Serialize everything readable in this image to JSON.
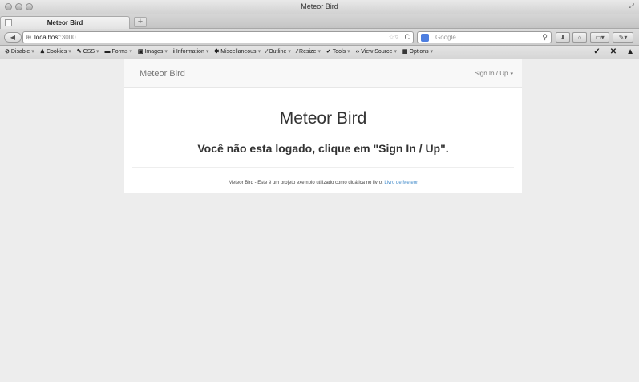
{
  "window": {
    "title": "Meteor Bird"
  },
  "tabs": [
    {
      "title": "Meteor Bird"
    }
  ],
  "navbar": {
    "url_host": "localhost",
    "url_port": ":3000",
    "search_placeholder": "Google"
  },
  "devbar": {
    "items": [
      {
        "glyph": "⊘",
        "label": "Disable"
      },
      {
        "glyph": "♟",
        "label": "Cookies"
      },
      {
        "glyph": "✎",
        "label": "CSS"
      },
      {
        "glyph": "▬",
        "label": "Forms"
      },
      {
        "glyph": "▣",
        "label": "Images"
      },
      {
        "glyph": "i",
        "label": "Information"
      },
      {
        "glyph": "✱",
        "label": "Miscellaneous"
      },
      {
        "glyph": "⁄",
        "label": "Outline"
      },
      {
        "glyph": "⁄",
        "label": "Resize"
      },
      {
        "glyph": "✔",
        "label": "Tools"
      },
      {
        "glyph": "‹›",
        "label": "View Source"
      },
      {
        "glyph": "▦",
        "label": "Options"
      }
    ]
  },
  "page": {
    "brand": "Meteor Bird",
    "signin_label": "Sign In / Up",
    "hero_title": "Meteor Bird",
    "hero_message": "Você não esta logado, clique em \"Sign In / Up\".",
    "footer_text": "Meteor Bird - Este é um projeto exemplo utilizado como didática no livro: ",
    "footer_link": "Livro de Meteor"
  }
}
